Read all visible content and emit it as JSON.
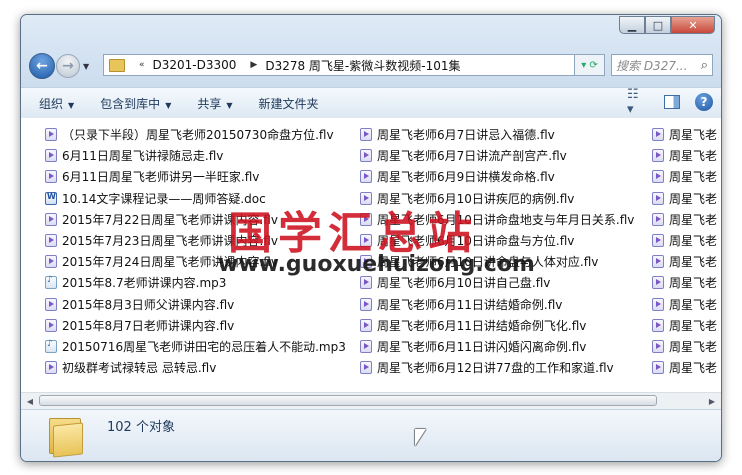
{
  "nav": {
    "breadcrumbs": [
      "D3201-D3300",
      "D3278 周飞星-紫微斗数视频-101集"
    ],
    "search_placeholder": "搜索 D327..."
  },
  "toolbar": {
    "organize": "组织",
    "include_in_library": "包含到库中",
    "share": "共享",
    "new_folder": "新建文件夹"
  },
  "files": {
    "column1": [
      {
        "name": "（只录下半段）周星飞老师20150730命盘方位.flv",
        "type": "flv"
      },
      {
        "name": "6月11日周星飞讲禄随忌走.flv",
        "type": "flv"
      },
      {
        "name": "6月11日周星飞老师讲另一半旺家.flv",
        "type": "flv"
      },
      {
        "name": "10.14文字课程记录——周师答疑.doc",
        "type": "doc"
      },
      {
        "name": "2015年7月22日周星飞老师讲课内容.flv",
        "type": "flv"
      },
      {
        "name": "2015年7月23日周星飞老师讲课内容.flv",
        "type": "flv"
      },
      {
        "name": "2015年7月24日周星飞老师讲课内容.flv",
        "type": "flv"
      },
      {
        "name": "2015年8.7老师讲课内容.mp3",
        "type": "mp3"
      },
      {
        "name": "2015年8月3日师父讲课内容.flv",
        "type": "flv"
      },
      {
        "name": "2015年8月7日老师讲课内容.flv",
        "type": "flv"
      },
      {
        "name": "20150716周星飞老师讲田宅的忌压着人不能动.mp3",
        "type": "mp3"
      },
      {
        "name": "初级群考试禄转忌 忌转忌.flv",
        "type": "flv"
      }
    ],
    "column2": [
      {
        "name": "周星飞老师6月7日讲忌入福德.flv",
        "type": "flv"
      },
      {
        "name": "周星飞老师6月7日讲流产剖宫产.flv",
        "type": "flv"
      },
      {
        "name": "周星飞老师6月9日讲横发命格.flv",
        "type": "flv"
      },
      {
        "name": "周星飞老师6月10日讲疾厄的病例.flv",
        "type": "flv"
      },
      {
        "name": "周星飞老师6月10日讲命盘地支与年月日关系.flv",
        "type": "flv"
      },
      {
        "name": "周星飞老师6月10日讲命盘与方位.flv",
        "type": "flv"
      },
      {
        "name": "周星飞老师6月10日讲命盘与人体对应.flv",
        "type": "flv"
      },
      {
        "name": "周星飞老师6月10日讲自己盘.flv",
        "type": "flv"
      },
      {
        "name": "周星飞老师6月11日讲结婚命例.flv",
        "type": "flv"
      },
      {
        "name": "周星飞老师6月11日讲结婚命例飞化.flv",
        "type": "flv"
      },
      {
        "name": "周星飞老师6月11日讲闪婚闪离命例.flv",
        "type": "flv"
      },
      {
        "name": "周星飞老师6月12日讲77盘的工作和家道.flv",
        "type": "flv"
      }
    ],
    "column3": [
      {
        "name": "周星飞老",
        "type": "flv"
      },
      {
        "name": "周星飞老",
        "type": "flv"
      },
      {
        "name": "周星飞老",
        "type": "flv"
      },
      {
        "name": "周星飞老",
        "type": "flv"
      },
      {
        "name": "周星飞老",
        "type": "flv"
      },
      {
        "name": "周星飞老",
        "type": "flv"
      },
      {
        "name": "周星飞老",
        "type": "flv"
      },
      {
        "name": "周星飞老",
        "type": "flv"
      },
      {
        "name": "周星飞老",
        "type": "flv"
      },
      {
        "name": "周星飞老",
        "type": "flv"
      },
      {
        "name": "周星飞老",
        "type": "flv"
      },
      {
        "name": "周星飞老",
        "type": "flv"
      }
    ]
  },
  "details": {
    "count": "102 个对象"
  },
  "watermark": {
    "chinese": "国学汇总站",
    "url": "www.guoxuehuizong.com"
  }
}
